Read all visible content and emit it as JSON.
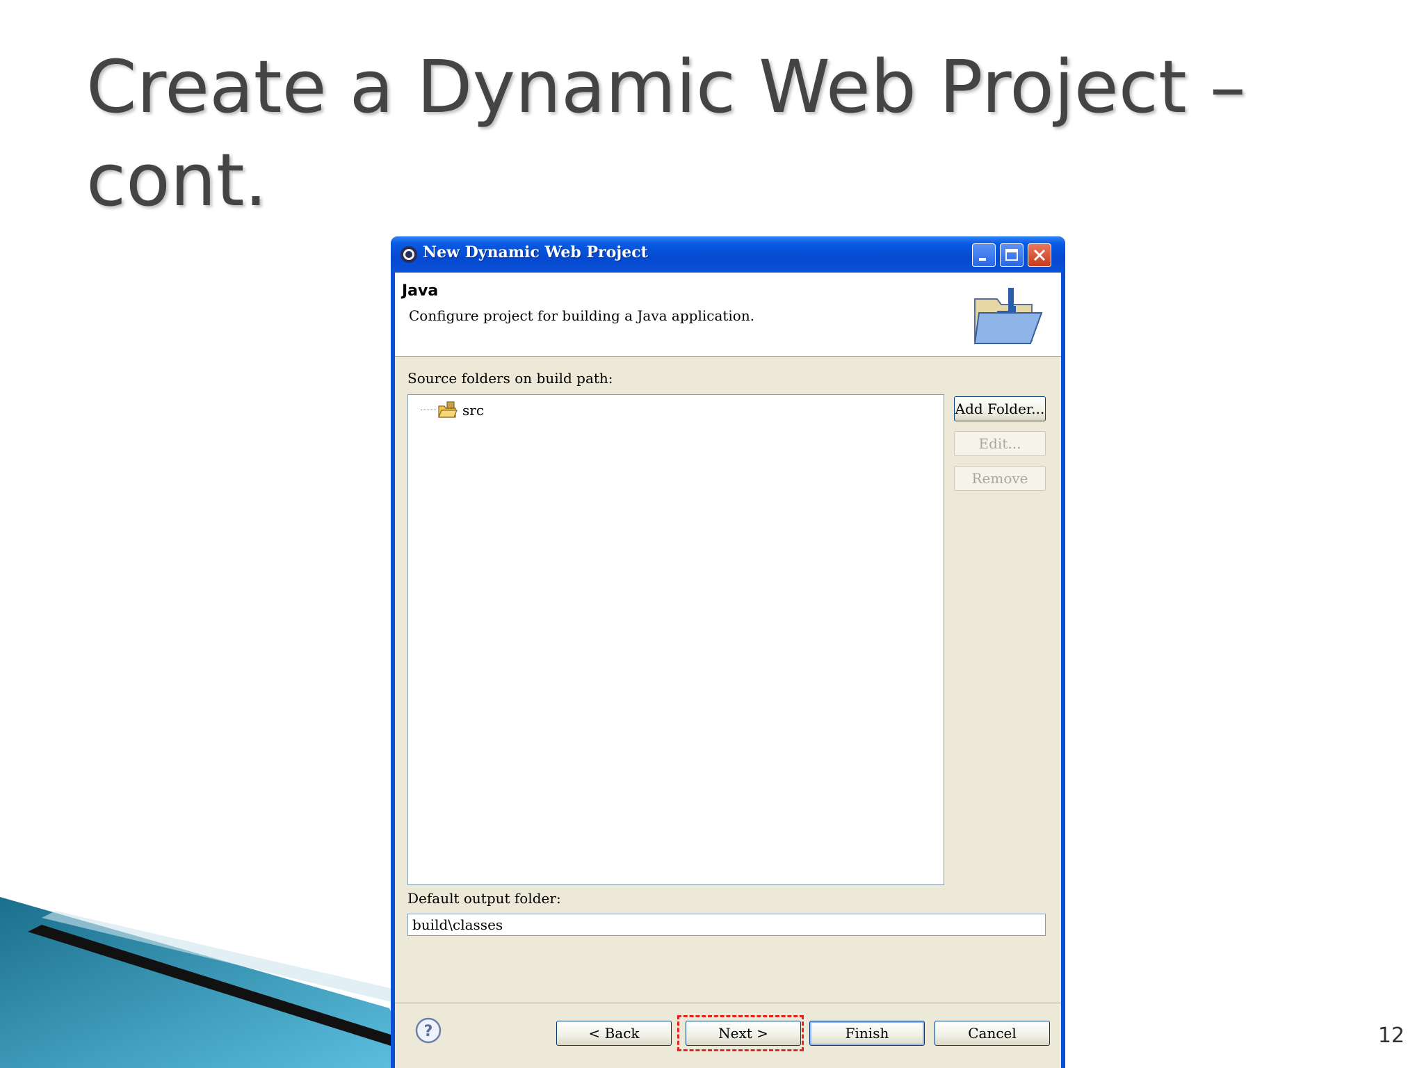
{
  "slide": {
    "title": "Create a Dynamic Web Project – cont.",
    "page_number": "12"
  },
  "window": {
    "title": "New Dynamic Web Project",
    "icons": {
      "app": "eclipse-icon",
      "minimize": "minimize-icon",
      "maximize": "maximize-icon",
      "close": "close-icon"
    }
  },
  "banner": {
    "title": "Java",
    "description": "Configure project for building a Java application.",
    "icon": "java-folder-icon"
  },
  "source": {
    "label": "Source folders on build path:",
    "items": [
      {
        "label": "src",
        "icon": "source-folder-icon"
      }
    ],
    "buttons": {
      "add_folder": "Add Folder...",
      "edit": "Edit...",
      "remove": "Remove"
    }
  },
  "output": {
    "label": "Default output folder:",
    "value": "build\\classes"
  },
  "footer": {
    "help_icon": "help-icon",
    "back": "< Back",
    "next": "Next >",
    "finish": "Finish",
    "cancel": "Cancel"
  },
  "colors": {
    "titlebar": "#0a4fd6",
    "dialog_bg": "#ece9d8",
    "highlight": "#e8221c"
  }
}
